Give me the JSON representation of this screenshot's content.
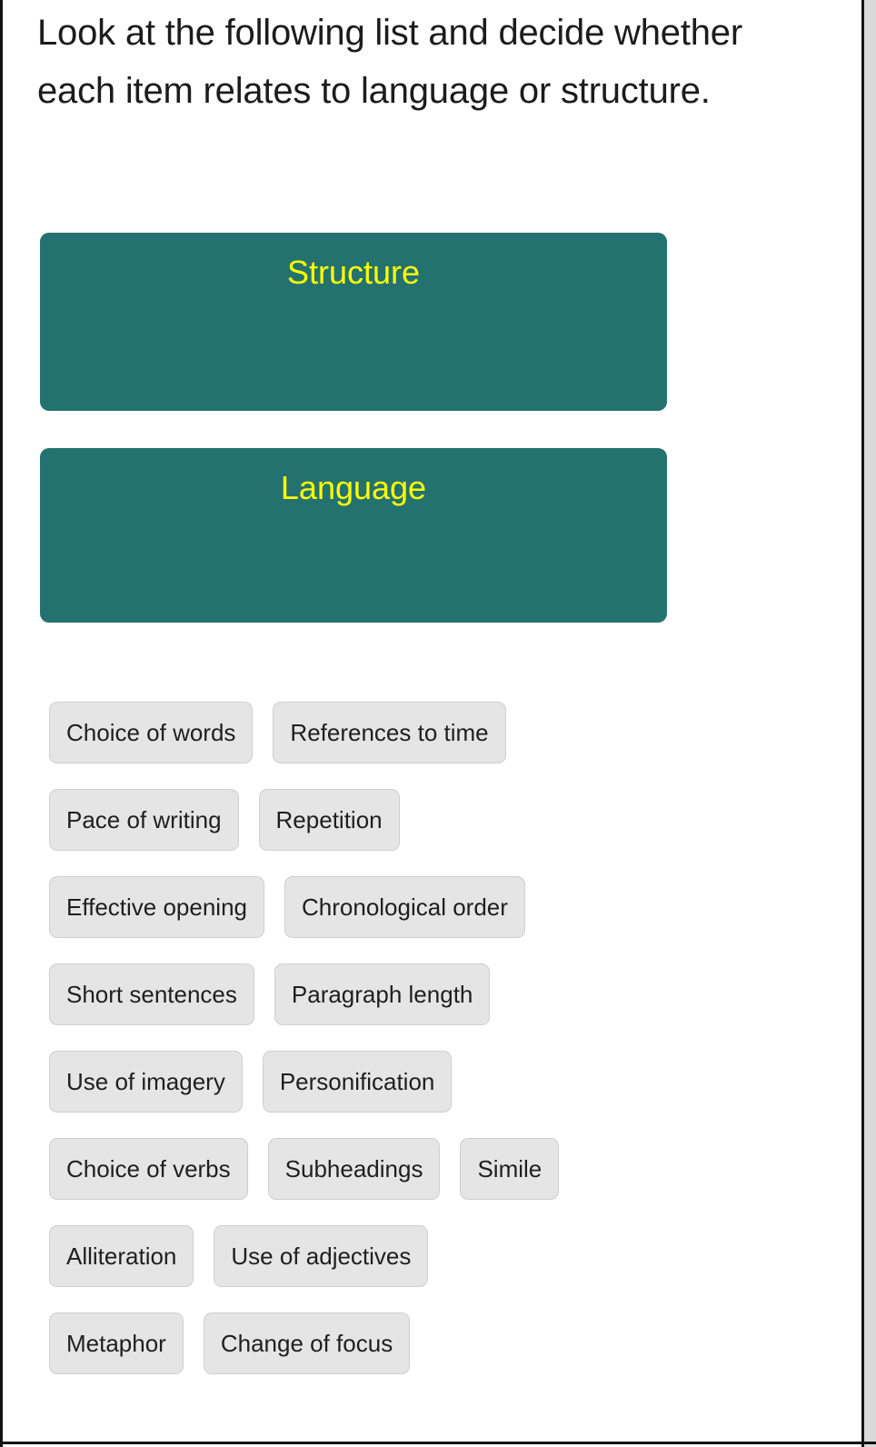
{
  "prompt": {
    "text": "Look at the following list and decide whether each item relates to language or structure."
  },
  "dropzones": [
    {
      "id": "structure",
      "label": "Structure"
    },
    {
      "id": "language",
      "label": "Language"
    }
  ],
  "colors": {
    "dropzone_background": "#24726f",
    "dropzone_text": "#ffff00",
    "chip_background": "#e5e5e5",
    "chip_border": "#cfcfcf",
    "chip_text": "#1f1f1f",
    "page_background": "#ffffff",
    "frame_line": "#121212"
  },
  "item_rows": [
    [
      "Choice of words",
      "References to time"
    ],
    [
      "Pace of writing",
      "Repetition"
    ],
    [
      "Effective opening",
      "Chronological order"
    ],
    [
      "Short sentences",
      "Paragraph length"
    ],
    [
      "Use of imagery",
      "Personification"
    ],
    [
      "Choice of verbs",
      "Subheadings",
      "Simile"
    ],
    [
      "Alliteration",
      "Use of adjectives"
    ],
    [
      "Metaphor",
      "Change of focus"
    ]
  ]
}
